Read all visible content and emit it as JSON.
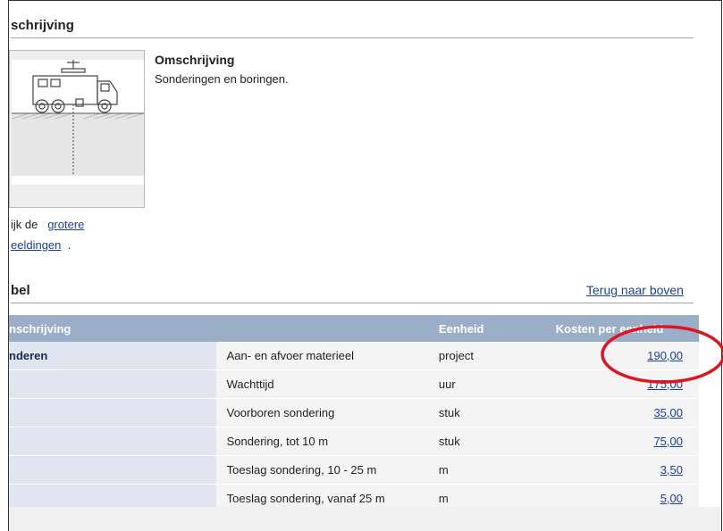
{
  "section1": {
    "title": "schrijving"
  },
  "description": {
    "heading": "Omschrijving",
    "text": "Sonderingen en boringen."
  },
  "image_note": {
    "line1_text": "ijk de",
    "line1_link": "grotere",
    "line2_link": "eeldingen",
    "line2_suffix": "."
  },
  "section2": {
    "title": "bel",
    "back_link": "Terug naar boven"
  },
  "table": {
    "headers": [
      "nschrijving",
      "",
      "Eenheid",
      "Kosten per eenheid"
    ],
    "category": "nderen",
    "rows": [
      {
        "item": "Aan- en afvoer materieel",
        "unit": "project",
        "cost": "190,00"
      },
      {
        "item": "Wachttijd",
        "unit": "uur",
        "cost": "175,00"
      },
      {
        "item": "Voorboren sondering",
        "unit": "stuk",
        "cost": "35,00"
      },
      {
        "item": "Sondering, tot 10 m",
        "unit": "stuk",
        "cost": "75,00"
      },
      {
        "item": "Toeslag sondering, 10 - 25 m",
        "unit": "m",
        "cost": "3,50"
      },
      {
        "item": "Toeslag sondering, vanaf 25 m",
        "unit": "m",
        "cost": "5,00"
      }
    ]
  },
  "colors": {
    "header_bg": "#9aaec8",
    "link": "#1a3f9a",
    "annotation": "#e0141e"
  }
}
